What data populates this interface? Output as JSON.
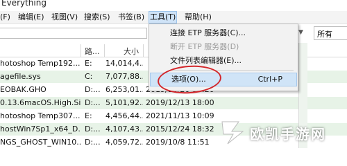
{
  "window": {
    "title": "Everything"
  },
  "menubar": {
    "items": [
      "(F)",
      "编辑(E)",
      "视图(V)",
      "搜索(S)",
      "书签(B)",
      "工具(T)",
      "帮助(H)"
    ]
  },
  "search": {
    "value": ""
  },
  "filter": {
    "selected": "所有"
  },
  "columns": {
    "path": "路...",
    "size": "大小"
  },
  "rows": [
    {
      "name": "hotoshop Temp192...",
      "path": "E:",
      "size": "14,014,4...",
      "date": ""
    },
    {
      "name": "agefile.sys",
      "path": "C:",
      "size": "7,077,88...",
      "date": ""
    },
    {
      "name": "EOBAK.GHO",
      "path": "D:...",
      "size": "6,253,01...",
      "date": "2019/10/20 13:20"
    },
    {
      "name": "0.13.6macOS.High.Si...",
      "path": "D:...",
      "size": "5,101,92...",
      "date": "2019/12/13 18:00"
    },
    {
      "name": "hotoshop Temp307...",
      "path": "E:",
      "size": "4,456,44...",
      "date": "2021/11/13 10:09"
    },
    {
      "name": "hostWin7Sp1_x64_D...",
      "path": "D:...",
      "size": "4,107,43...",
      "date": "2015/12/24 18:32"
    },
    {
      "name": "NGS_GHOST_WIN10...",
      "path": "D:...",
      "size": "4,059,72...",
      "date": "2019/10/8 11:51"
    }
  ],
  "tools_menu": {
    "items": [
      {
        "label": "连接 ETP 服务器(C)...",
        "shortcut": "",
        "disabled": false
      },
      {
        "label": "断开 ETP 服务器(D)",
        "shortcut": "",
        "disabled": true
      },
      {
        "label": "文件列表编辑器(E)...",
        "shortcut": "",
        "disabled": false
      },
      {
        "label": "选项(O)...",
        "shortcut": "Ctrl+P",
        "disabled": false
      }
    ]
  },
  "watermark": {
    "text": "欧凯手游网"
  },
  "colors": {
    "highlight": "#d0e4f7",
    "row_alt": "#e7f3e7",
    "annotation": "#d3272b"
  }
}
